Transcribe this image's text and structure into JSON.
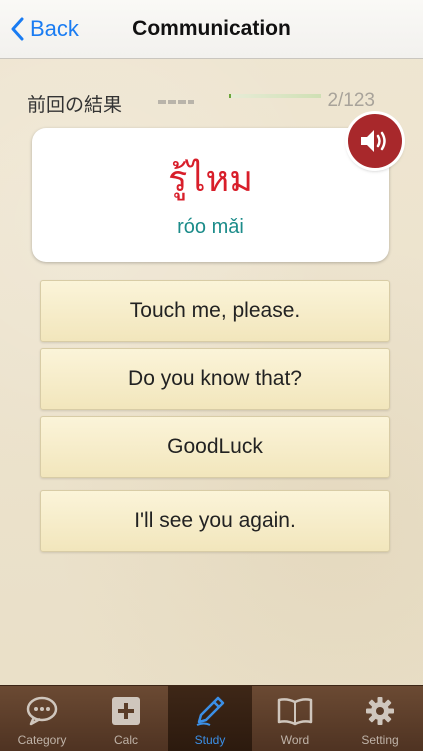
{
  "navbar": {
    "back_label": "Back",
    "title": "Communication"
  },
  "status": {
    "label": "前回の結果",
    "progress_fraction": 0.02,
    "count": "2/123"
  },
  "card": {
    "thai": "รู้ไหม",
    "romanization": "róo mǎi"
  },
  "choices": [
    "Touch me, please.",
    "Do you know that?",
    "GoodLuck",
    "I'll see you again."
  ],
  "tabs": [
    {
      "label": "Category",
      "icon": "chat-bubble-icon"
    },
    {
      "label": "Calc",
      "icon": "plus-square-icon"
    },
    {
      "label": "Study",
      "icon": "pen-icon",
      "active": true
    },
    {
      "label": "Word",
      "icon": "book-icon"
    },
    {
      "label": "Setting",
      "icon": "gear-icon"
    }
  ],
  "colors": {
    "accent_blue": "#1a7cf2",
    "thai_red": "#d81e2a",
    "romanization_teal": "#1c8c8a",
    "speaker_red": "#a8282b",
    "tab_active": "#3b8fe6"
  }
}
